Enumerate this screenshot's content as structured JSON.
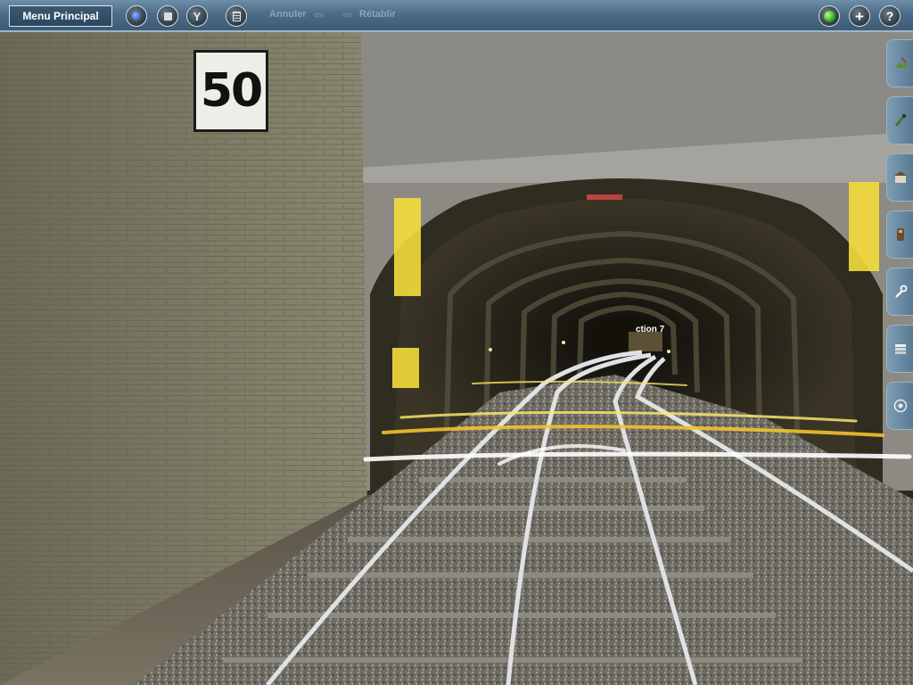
{
  "toolbar": {
    "menu_label": "Menu Principal",
    "undo_label": "Annuler",
    "redo_label": "Rétablir",
    "left_buttons": [
      {
        "icon": "blue-orb-icon"
      },
      {
        "icon": "stop-icon"
      },
      {
        "icon": "signal-icon"
      },
      {
        "icon": "calculator-icon"
      }
    ],
    "right_buttons": [
      {
        "icon": "green-status-icon"
      },
      {
        "icon": "plus-icon"
      },
      {
        "icon": "help-icon"
      }
    ]
  },
  "sidepanel": {
    "tabs": [
      {
        "icon": "terrain-brush-icon"
      },
      {
        "icon": "paint-brush-icon"
      },
      {
        "icon": "building-icon"
      },
      {
        "icon": "track-object-icon"
      },
      {
        "icon": "wrench-icon"
      },
      {
        "icon": "layers-icon"
      },
      {
        "icon": "compass-icon"
      }
    ]
  },
  "scene": {
    "speed_sign": "50",
    "section_marker": "ction 7"
  },
  "colors": {
    "toolbar": "#4c6c87",
    "tunnel_wall": "#2d2a1f",
    "concrete": "#8a8a86",
    "marker_yellow": "#f4dc3a"
  }
}
